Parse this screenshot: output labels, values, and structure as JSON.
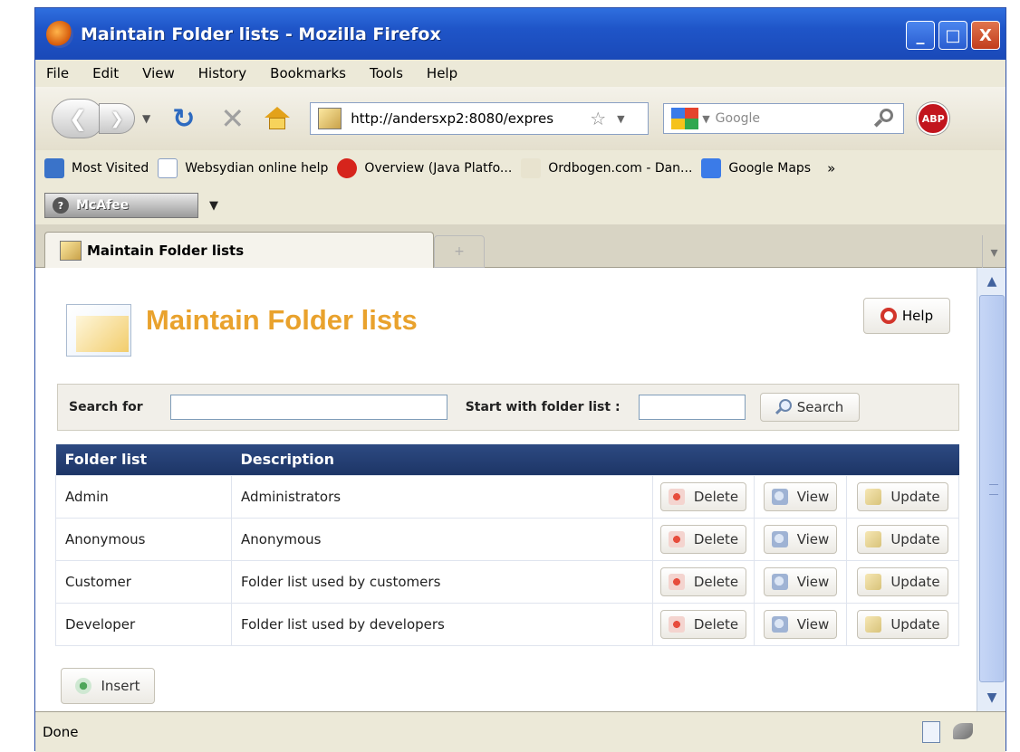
{
  "window": {
    "title": "Maintain Folder lists - Mozilla Firefox",
    "controls": {
      "minimize": "_",
      "maximize": "□",
      "close": "X"
    }
  },
  "menubar": [
    "File",
    "Edit",
    "View",
    "History",
    "Bookmarks",
    "Tools",
    "Help"
  ],
  "navbar": {
    "back_icon": "back-arrow-icon",
    "forward_icon": "forward-arrow-icon",
    "url": "http://andersxp2:8080/expres",
    "search_placeholder": "Google",
    "adblock_label": "ABP"
  },
  "bookmarks": [
    {
      "label": "Most Visited",
      "color": "#3a73c9"
    },
    {
      "label": "Websydian online help",
      "color": "#ffffff"
    },
    {
      "label": "Overview (Java Platfo...",
      "color": "#d6241c"
    },
    {
      "label": "Ordbogen.com - Dan...",
      "color": "#e8e3cf"
    },
    {
      "label": "Google Maps",
      "color": "#3b7be8"
    }
  ],
  "bookmarks_more": "»",
  "mcafee": {
    "label": "McAfee"
  },
  "tab": {
    "label": "Maintain Folder lists",
    "new_tab": "+"
  },
  "page": {
    "title": "Maintain Folder lists",
    "help_label": "Help",
    "search": {
      "search_for_label": "Search for",
      "search_for_value": "",
      "start_with_label": "Start with folder list :",
      "start_with_value": "",
      "button_label": "Search"
    },
    "table": {
      "headers": [
        "Folder list",
        "Description"
      ],
      "rows": [
        {
          "name": "Admin",
          "description": "Administrators"
        },
        {
          "name": "Anonymous",
          "description": "Anonymous"
        },
        {
          "name": "Customer",
          "description": "Folder list used by customers"
        },
        {
          "name": "Developer",
          "description": "Folder list used by developers"
        }
      ],
      "actions": {
        "delete": "Delete",
        "view": "View",
        "update": "Update"
      }
    },
    "insert_label": "Insert"
  },
  "status": {
    "text": "Done"
  },
  "colors": {
    "title_accent": "#e9a22d",
    "table_header": "#1d3566",
    "titlebar": "#1f55c8"
  }
}
